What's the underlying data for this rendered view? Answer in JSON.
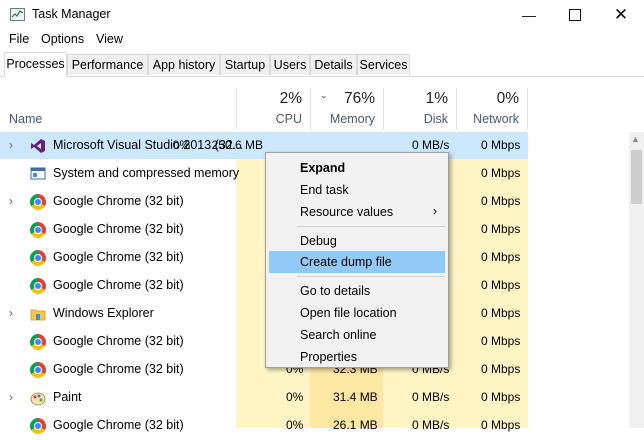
{
  "window": {
    "title": "Task Manager",
    "minimize_icon": "minimize-icon",
    "maximize_icon": "maximize-icon",
    "close_icon": "close-icon"
  },
  "menu": [
    "File",
    "Options",
    "View"
  ],
  "tabs": [
    "Processes",
    "Performance",
    "App history",
    "Startup",
    "Users",
    "Details",
    "Services"
  ],
  "columns": {
    "name": "Name",
    "cpu": {
      "pct": "2%",
      "label": "CPU"
    },
    "memory": {
      "pct": "76%",
      "label": "Memory"
    },
    "disk": {
      "pct": "1%",
      "label": "Disk"
    },
    "network": {
      "pct": "0%",
      "label": "Network"
    }
  },
  "rows": [
    {
      "name": "Microsoft Visual Studio 2013 (32...",
      "cpu": "0%",
      "memory": "250.6 MB",
      "disk": "0 MB/s",
      "network": "0 Mbps",
      "icon": "visual-studio-icon"
    },
    {
      "name": "System and compressed memory",
      "cpu": "",
      "memory": "",
      "disk": "",
      "network": "0 Mbps",
      "icon": "system-icon"
    },
    {
      "name": "Google Chrome (32 bit)",
      "cpu": "",
      "memory": "",
      "disk": "",
      "network": "0 Mbps",
      "icon": "chrome-icon"
    },
    {
      "name": "Google Chrome (32 bit)",
      "cpu": "",
      "memory": "",
      "disk": "",
      "network": "0 Mbps",
      "icon": "chrome-icon"
    },
    {
      "name": "Google Chrome (32 bit)",
      "cpu": "",
      "memory": "",
      "disk": "",
      "network": "0 Mbps",
      "icon": "chrome-icon"
    },
    {
      "name": "Google Chrome (32 bit)",
      "cpu": "",
      "memory": "",
      "disk": "",
      "network": "0 Mbps",
      "icon": "chrome-icon"
    },
    {
      "name": "Windows Explorer",
      "cpu": "",
      "memory": "",
      "disk": "",
      "network": "0 Mbps",
      "icon": "folder-icon"
    },
    {
      "name": "Google Chrome (32 bit)",
      "cpu": "",
      "memory": "",
      "disk": "",
      "network": "0 Mbps",
      "icon": "chrome-icon"
    },
    {
      "name": "Google Chrome (32 bit)",
      "cpu": "0%",
      "memory": "32.3 MB",
      "disk": "0 MB/s",
      "network": "0 Mbps",
      "icon": "chrome-icon"
    },
    {
      "name": "Paint",
      "cpu": "0%",
      "memory": "31.4 MB",
      "disk": "0 MB/s",
      "network": "0 Mbps",
      "icon": "paint-icon"
    },
    {
      "name": "Google Chrome (32 bit)",
      "cpu": "0%",
      "memory": "26.1 MB",
      "disk": "0 MB/s",
      "network": "0 Mbps",
      "icon": "chrome-icon"
    }
  ],
  "context_menu": {
    "items": [
      "Expand",
      "End task",
      "Resource values",
      "Debug",
      "Create dump file",
      "Go to details",
      "Open file location",
      "Search online",
      "Properties"
    ],
    "highlighted": "Create dump file"
  },
  "colors": {
    "selected_row": "#cce8ff",
    "menu_highlight": "#91c9f7",
    "heat_light": "#fff4c4",
    "heat_medium": "#ffe8a3"
  }
}
